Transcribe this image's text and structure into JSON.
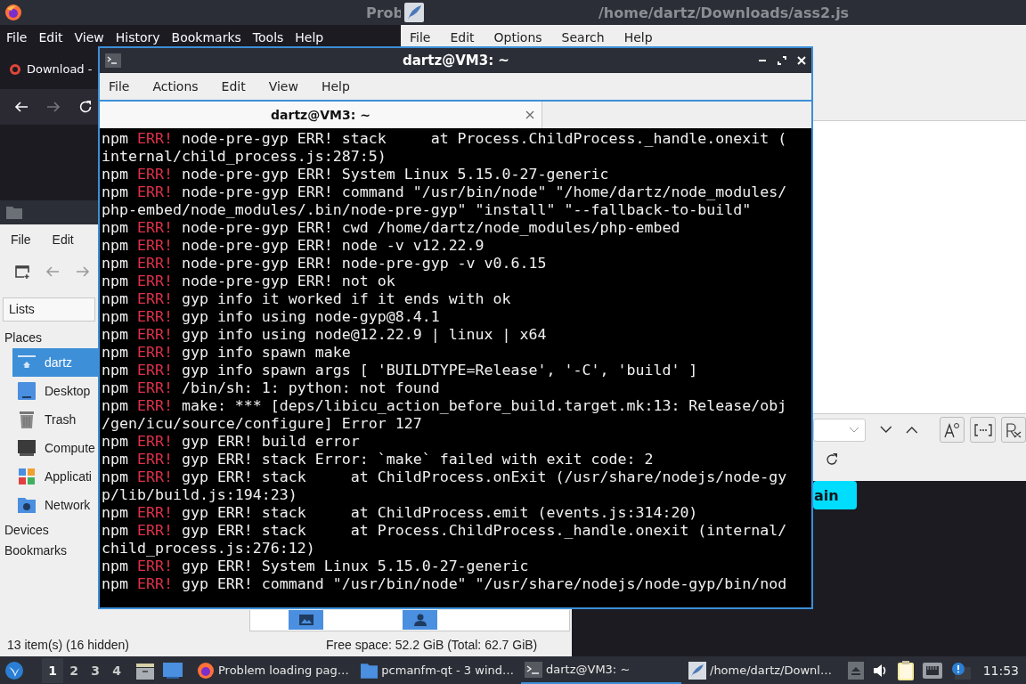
{
  "firefox": {
    "title": "Prob",
    "menu": [
      "File",
      "Edit",
      "View",
      "History",
      "Bookmarks",
      "Tools",
      "Help"
    ],
    "tab": "Download -",
    "page_button": "ain"
  },
  "editor": {
    "title": "/home/dartz/Downloads/ass2.js",
    "menu": [
      "File",
      "Edit",
      "Options",
      "Search",
      "Help"
    ]
  },
  "file_manager": {
    "menu": [
      "File",
      "Edit"
    ],
    "view_mode": "Lists",
    "places_heading": "Places",
    "places": [
      {
        "label": "dartz",
        "kind": "home",
        "selected": true
      },
      {
        "label": "Desktop",
        "kind": "desktop",
        "selected": false
      },
      {
        "label": "Trash",
        "kind": "trash",
        "selected": false
      },
      {
        "label": "Compute",
        "kind": "computer",
        "selected": false
      },
      {
        "label": "Applicati",
        "kind": "apps",
        "selected": false
      },
      {
        "label": "Network",
        "kind": "network",
        "selected": false
      }
    ],
    "other_headings": [
      "Devices",
      "Bookmarks"
    ],
    "status": "13 item(s) (16 hidden)",
    "free_space": "Free space: 52.2 GiB (Total: 62.7 GiB)"
  },
  "terminal": {
    "title": "dartz@VM3: ~",
    "menu": [
      "File",
      "Actions",
      "Edit",
      "View",
      "Help"
    ],
    "tab": "dartz@VM3: ~",
    "lines": [
      {
        "program": "npm",
        "severity": "ERR!",
        "text": "node-pre-gyp ERR! stack     at Process.ChildProcess._handle.onexit ("
      },
      {
        "text": "internal/child_process.js:287:5)"
      },
      {
        "program": "npm",
        "severity": "ERR!",
        "text": "node-pre-gyp ERR! System Linux 5.15.0-27-generic"
      },
      {
        "program": "npm",
        "severity": "ERR!",
        "text": "node-pre-gyp ERR! command \"/usr/bin/node\" \"/home/dartz/node_modules/"
      },
      {
        "text": "php-embed/node_modules/.bin/node-pre-gyp\" \"install\" \"--fallback-to-build\""
      },
      {
        "program": "npm",
        "severity": "ERR!",
        "text": "node-pre-gyp ERR! cwd /home/dartz/node_modules/php-embed"
      },
      {
        "program": "npm",
        "severity": "ERR!",
        "text": "node-pre-gyp ERR! node -v v12.22.9"
      },
      {
        "program": "npm",
        "severity": "ERR!",
        "text": "node-pre-gyp ERR! node-pre-gyp -v v0.6.15"
      },
      {
        "program": "npm",
        "severity": "ERR!",
        "text": "node-pre-gyp ERR! not ok"
      },
      {
        "program": "npm",
        "severity": "ERR!",
        "text": "gyp info it worked if it ends with ok"
      },
      {
        "program": "npm",
        "severity": "ERR!",
        "text": "gyp info using node-gyp@8.4.1"
      },
      {
        "program": "npm",
        "severity": "ERR!",
        "text": "gyp info using node@12.22.9 | linux | x64"
      },
      {
        "program": "npm",
        "severity": "ERR!",
        "text": "gyp info spawn make"
      },
      {
        "program": "npm",
        "severity": "ERR!",
        "text": "gyp info spawn args [ 'BUILDTYPE=Release', '-C', 'build' ]"
      },
      {
        "program": "npm",
        "severity": "ERR!",
        "text": "/bin/sh: 1: python: not found"
      },
      {
        "program": "npm",
        "severity": "ERR!",
        "text": "make: *** [deps/libicu_action_before_build.target.mk:13: Release/obj"
      },
      {
        "text": "/gen/icu/source/configure] Error 127"
      },
      {
        "program": "npm",
        "severity": "ERR!",
        "text": "gyp ERR! build error"
      },
      {
        "program": "npm",
        "severity": "ERR!",
        "text": "gyp ERR! stack Error: `make` failed with exit code: 2"
      },
      {
        "program": "npm",
        "severity": "ERR!",
        "text": "gyp ERR! stack     at ChildProcess.onExit (/usr/share/nodejs/node-gy"
      },
      {
        "text": "p/lib/build.js:194:23)"
      },
      {
        "program": "npm",
        "severity": "ERR!",
        "text": "gyp ERR! stack     at ChildProcess.emit (events.js:314:20)"
      },
      {
        "program": "npm",
        "severity": "ERR!",
        "text": "gyp ERR! stack     at Process.ChildProcess._handle.onexit (internal/"
      },
      {
        "text": "child_process.js:276:12)"
      },
      {
        "program": "npm",
        "severity": "ERR!",
        "text": "gyp ERR! System Linux 5.15.0-27-generic"
      },
      {
        "program": "npm",
        "severity": "ERR!",
        "text": "gyp ERR! command \"/usr/bin/node\" \"/usr/share/nodejs/node-gyp/bin/nod"
      }
    ]
  },
  "taskbar": {
    "workspaces": [
      {
        "label": "1",
        "selected": true
      },
      {
        "label": "2",
        "selected": false
      },
      {
        "label": "3",
        "selected": false
      },
      {
        "label": "4",
        "selected": false
      }
    ],
    "tasks": [
      {
        "label": "Problem loading pag…",
        "kind": "browser",
        "selected": false
      },
      {
        "label": "pcmanfm-qt - 3 wind…",
        "kind": "folder",
        "selected": false
      },
      {
        "label": "dartz@VM3: ~",
        "kind": "terminal",
        "selected": true
      },
      {
        "label": "/home/dartz/Downl…",
        "kind": "editor",
        "selected": false
      }
    ],
    "clock": "11:53"
  }
}
